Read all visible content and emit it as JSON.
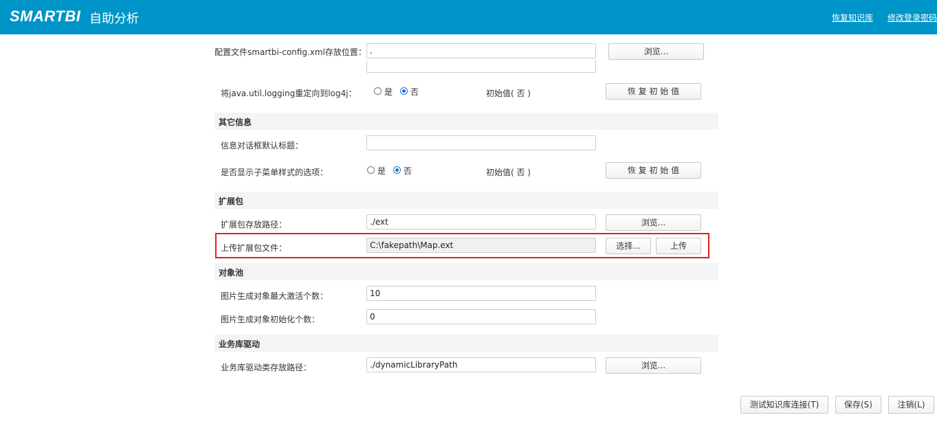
{
  "header": {
    "logo": "SMARTBI",
    "subtitle": "自助分析",
    "restore_kb": "恢复知识库",
    "change_pwd": "修改登录密码"
  },
  "config": {
    "path_label": "配置文件smartbi-config.xml存放位置：",
    "path_value": ".",
    "browse": "浏览...",
    "log_label": "将java.util.logging重定向到log4j：",
    "yes": "是",
    "no": "否",
    "initial": "初始值( 否 )",
    "restore": "恢 复 初 始 值"
  },
  "other": {
    "title": "其它信息",
    "dialog_title_label": "信息对话框默认标题：",
    "dialog_title_value": "",
    "submenu_label": "是否显示子菜单样式的选项：",
    "yes": "是",
    "no": "否",
    "initial": "初始值( 否 )",
    "restore": "恢 复 初 始 值"
  },
  "ext": {
    "title": "扩展包",
    "path_label": "扩展包存放路径：",
    "path_value": "./ext",
    "browse": "浏览...",
    "upload_label": "上传扩展包文件：",
    "upload_value": "C:\\fakepath\\Map.ext",
    "choose": "选择...",
    "upload": "上传"
  },
  "pool": {
    "title": "对象池",
    "max_label": "图片生成对象最大激活个数：",
    "max_value": "10",
    "init_label": "图片生成对象初始化个数：",
    "init_value": "0"
  },
  "driver": {
    "title": "业务库驱动",
    "path_label": "业务库驱动类存放路径：",
    "path_value": "./dynamicLibraryPath",
    "browse": "浏览..."
  },
  "footer": {
    "test": "测试知识库连接(T)",
    "save": "保存(S)",
    "logout": "注销(L)"
  }
}
